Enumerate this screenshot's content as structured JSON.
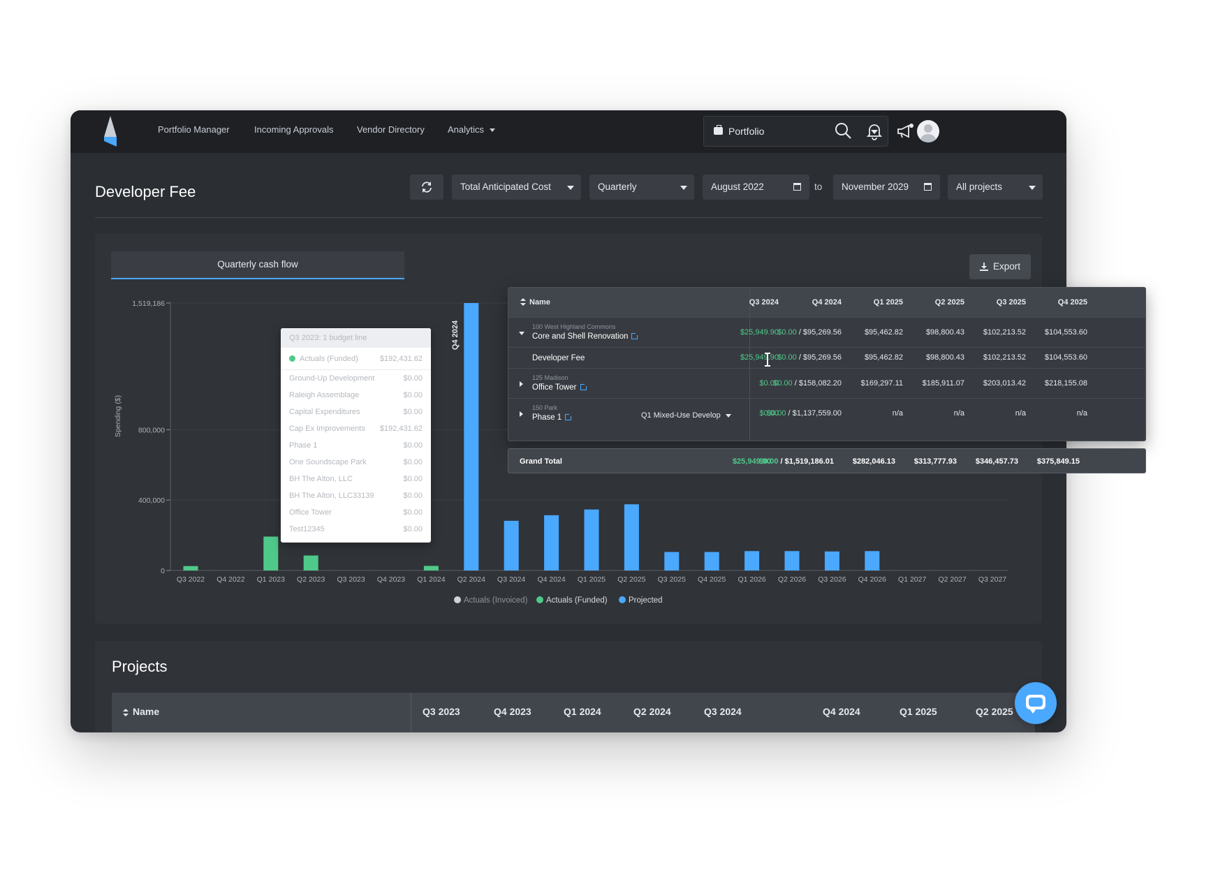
{
  "nav": {
    "items": [
      "Portfolio Manager",
      "Incoming Approvals",
      "Vendor Directory",
      "Analytics"
    ],
    "portfolio_label": "Portfolio"
  },
  "header": {
    "title": "Developer Fee",
    "metric": "Total Anticipated Cost",
    "period": "Quarterly",
    "date_from": "August  2022",
    "to": "to",
    "date_to": "November  2029",
    "projects": "All projects"
  },
  "panel": {
    "tab": "Quarterly cash flow",
    "export": "Export"
  },
  "colors": {
    "accent": "#4aa8ff",
    "funded": "#4fc98a",
    "invoiced": "#cfd3d8"
  },
  "chart_data": {
    "type": "bar",
    "categories": [
      "Q3 2022",
      "Q4 2022",
      "Q1 2023",
      "Q2 2023",
      "Q3 2023",
      "Q4 2023",
      "Q1 2024",
      "Q2 2024",
      "Q3 2024",
      "Q4 2024",
      "Q1 2025",
      "Q2 2025",
      "Q3 2025",
      "Q4 2025",
      "Q1 2026",
      "Q2 2026",
      "Q3 2026",
      "Q4 2026",
      "Q1 2027",
      "Q2 2027",
      "Q3 2027"
    ],
    "series": [
      {
        "name": "Actuals (Invoiced)",
        "values": [
          0,
          0,
          0,
          0,
          0,
          0,
          0,
          0,
          0,
          0,
          0,
          0,
          0,
          0,
          0,
          0,
          0,
          0,
          0,
          0,
          0
        ]
      },
      {
        "name": "Actuals (Funded)",
        "values": [
          25000,
          0,
          192431,
          85000,
          0,
          0,
          25950,
          0,
          0,
          0,
          0,
          0,
          0,
          0,
          0,
          0,
          0,
          0,
          0,
          0,
          0
        ]
      },
      {
        "name": "Projected",
        "values": [
          0,
          0,
          0,
          0,
          0,
          0,
          0,
          1519186,
          282046,
          313778,
          346458,
          375849,
          105000,
          105000,
          110000,
          110000,
          108000,
          110000,
          0,
          0,
          0
        ]
      }
    ],
    "y_ticks": [
      "1,519,186",
      "800,000",
      "400,000",
      "0"
    ],
    "ylim": [
      0,
      1519186
    ],
    "ylabel": "Spending ($)",
    "highlight_label": "Q4 2024",
    "legend": [
      "Actuals (Invoiced)",
      "Actuals (Funded)",
      "Projected"
    ]
  },
  "tooltip": {
    "title": "Q3 2023: 1 budget line",
    "first": {
      "label": "Actuals (Funded)",
      "value": "$192,431.62"
    },
    "rows": [
      {
        "label": "Ground-Up Development",
        "value": "$0.00"
      },
      {
        "label": "Raleigh Assemblage",
        "value": "$0.00"
      },
      {
        "label": "Capital Expenditures",
        "value": "$0.00"
      },
      {
        "label": "Cap Ex Improvements",
        "value": "$192,431.62"
      },
      {
        "label": "Phase 1",
        "value": "$0.00"
      },
      {
        "label": "One Soundscape Park",
        "value": "$0.00"
      },
      {
        "label": "BH The Alton, LLC",
        "value": "$0.00"
      },
      {
        "label": "BH The Alton, LLC33139",
        "value": "$0.00"
      },
      {
        "label": "Office Tower",
        "value": "$0.00"
      },
      {
        "label": "Test12345",
        "value": "$0.00"
      }
    ]
  },
  "table": {
    "name_header": "Name",
    "columns": [
      "Q3 2024",
      "Q4 2024",
      "Q1 2025",
      "Q2 2025",
      "Q3 2025",
      "Q4 2025"
    ],
    "rows": [
      {
        "sub": "100 West Highland Commons",
        "name": "Core and Shell Renovation",
        "c1": "$25,949.90",
        "c2a": "$0.00",
        "c2b": " / $95,269.56",
        "c3": "$95,462.82",
        "c4": "$98,800.43",
        "c5": "$102,213.52",
        "c6": "$104,553.60"
      },
      {
        "sub": "",
        "name": "Developer Fee",
        "c1": "$25,949.90",
        "c2a": "$0.00",
        "c2b": " / $95,269.56",
        "c3": "$95,462.82",
        "c4": "$98,800.43",
        "c5": "$102,213.52",
        "c6": "$104,553.60"
      },
      {
        "sub": "125 Madison",
        "name": "Office Tower",
        "c1": "$0.00",
        "c2a": "$0.00",
        "c2b": " / $158,082.20",
        "c3": "$169,297.11",
        "c4": "$185,911.07",
        "c5": "$203,013.42",
        "c6": "$218,155.08"
      },
      {
        "sub": "150 Park",
        "name": "Phase 1",
        "select": "Q1 Mixed-Use Develop",
        "c1": "$0.00",
        "c2a": "$0.00",
        "c2b": " / $1,137,559.00",
        "c3": "n/a",
        "c4": "n/a",
        "c5": "n/a",
        "c6": "n/a"
      }
    ],
    "grand_total": {
      "label": "Grand Total",
      "c1": "$25,949.90",
      "c2a": "$0.00",
      "c2b": " / $1,519,186.01",
      "c3": "$282,046.13",
      "c4": "$313,777.93",
      "c5": "$346,457.73",
      "c6": "$375,849.15"
    }
  },
  "projects": {
    "title": "Projects",
    "name_header": "Name",
    "columns": [
      "Q3 2023",
      "Q4 2023",
      "Q1 2024",
      "Q2 2024",
      "Q3 2024",
      "Q4 2024",
      "Q1 2025",
      "Q2 2025"
    ]
  }
}
